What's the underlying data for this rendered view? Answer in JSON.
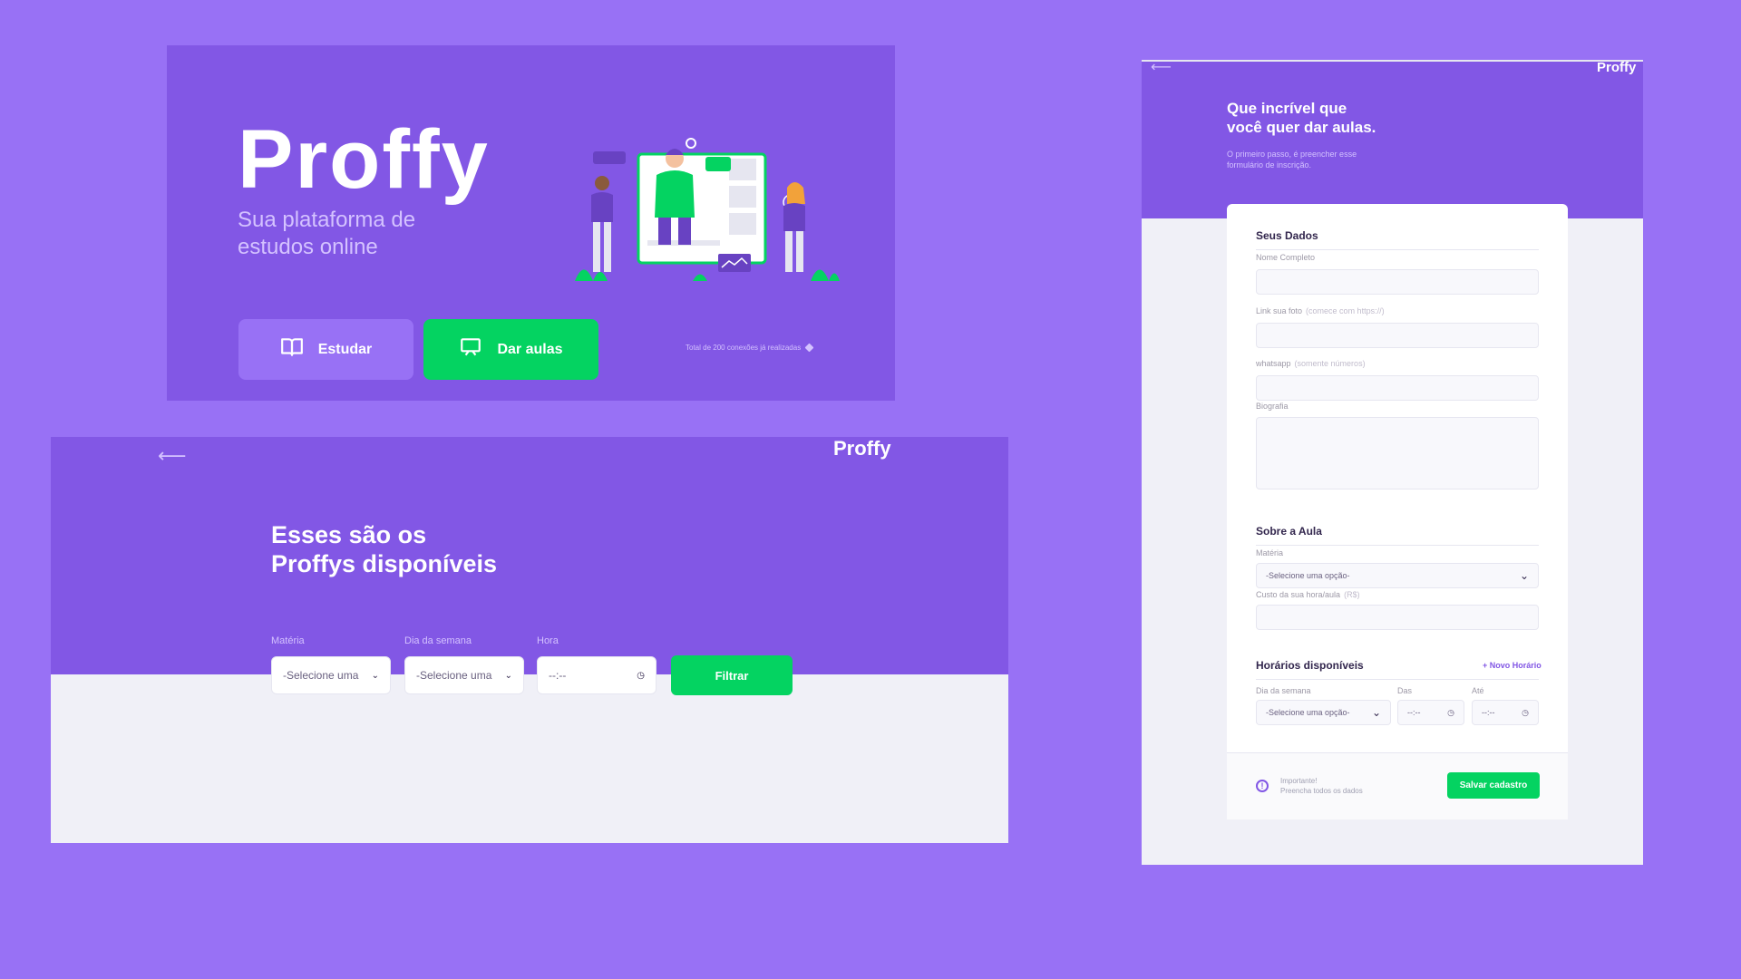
{
  "colors": {
    "background": "#9871F5",
    "primary": "#8257E5",
    "secondary": "#04D361",
    "surface": "#F0F0F7"
  },
  "landing": {
    "logo": "Proffy",
    "tagline": "Sua plataforma de estudos online",
    "study_label": "Estudar",
    "study_icon": "book-open-icon",
    "teach_label": "Dar aulas",
    "teach_icon": "presentation-icon",
    "connections": "Total de 200 conexões já realizadas"
  },
  "list_page": {
    "back_icon": "arrow-left-icon",
    "brand": "Proffy",
    "title_line1": "Esses são os",
    "title_line2": "Proffys disponíveis",
    "filters": {
      "subject_label": "Matéria",
      "subject_value": "-Selecione uma",
      "weekday_label": "Dia da semana",
      "weekday_value": "-Selecione uma",
      "time_label": "Hora",
      "time_value": "--:--"
    },
    "filter_button": "Filtrar"
  },
  "form_page": {
    "back_icon": "arrow-left-icon",
    "brand": "Proffy",
    "title_line1": "Que incrível que",
    "title_line2": "você quer dar aulas.",
    "description": "O primeiro passo, é preencher esse formulário de inscrição.",
    "section_data": "Seus Dados",
    "name_label": "Nome Completo",
    "photo_label": "Link sua foto",
    "photo_hint": "(comece com https://)",
    "whatsapp_label": "whatsapp",
    "whatsapp_hint": "(somente números)",
    "bio_label": "Biografia",
    "section_class": "Sobre a Aula",
    "subject_label": "Matéria",
    "subject_value": "-Selecione uma opção-",
    "cost_label": "Custo da sua hora/aula",
    "cost_hint": "(R$)",
    "section_schedule": "Horários disponíveis",
    "new_schedule": "+ Novo Horário",
    "weekday_label": "Dia da semana",
    "weekday_value": "-Selecione uma opção-",
    "from_label": "Das",
    "from_value": "--:--",
    "to_label": "Até",
    "to_value": "--:--",
    "warning_title": "Importante!",
    "warning_text": "Preencha todos os dados",
    "save_button": "Salvar cadastro"
  }
}
